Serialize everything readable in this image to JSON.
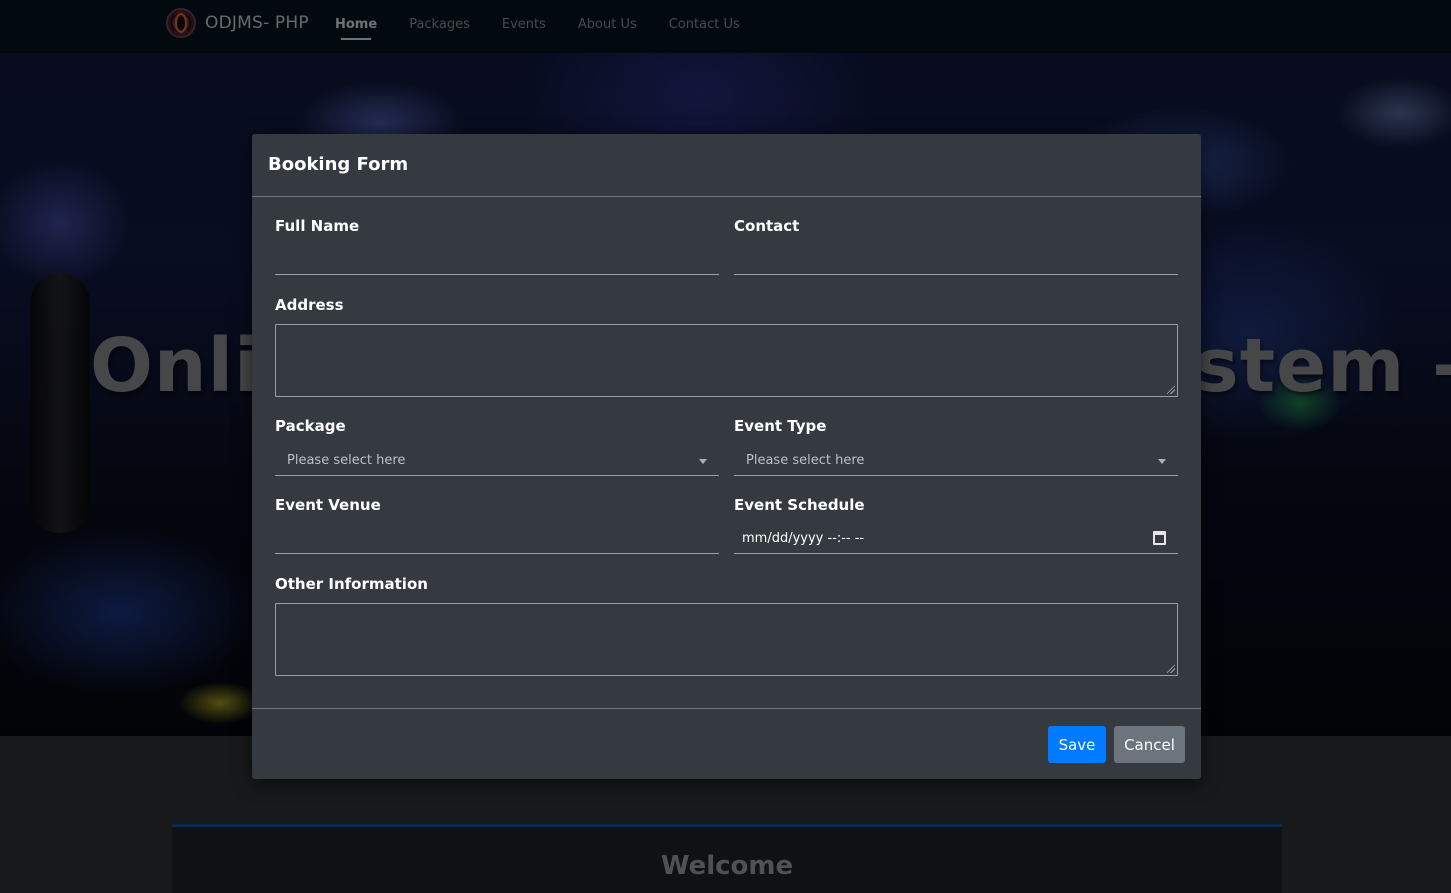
{
  "navbar": {
    "brand": "ODJMS- PHP",
    "items": [
      {
        "label": "Home",
        "active": true
      },
      {
        "label": "Packages",
        "active": false
      },
      {
        "label": "Events",
        "active": false
      },
      {
        "label": "About Us",
        "active": false
      },
      {
        "label": "Contact Us",
        "active": false
      }
    ]
  },
  "hero": {
    "title": "Online DJ Management System - PHP"
  },
  "welcome": {
    "title": "Welcome"
  },
  "modal": {
    "title": "Booking Form",
    "fields": {
      "full_name": {
        "label": "Full Name",
        "value": ""
      },
      "contact": {
        "label": "Contact",
        "value": ""
      },
      "address": {
        "label": "Address",
        "value": ""
      },
      "package": {
        "label": "Package",
        "placeholder": "Please select here"
      },
      "event_type": {
        "label": "Event Type",
        "placeholder": "Please select here"
      },
      "event_venue": {
        "label": "Event Venue",
        "value": ""
      },
      "event_schedule": {
        "label": "Event Schedule",
        "value": "mm/dd/yyyy --:-- --"
      },
      "other_info": {
        "label": "Other Information",
        "value": ""
      }
    },
    "buttons": {
      "save": "Save",
      "cancel": "Cancel"
    }
  },
  "colors": {
    "navbar_bg": "#04131f",
    "modal_bg": "#343a40",
    "primary": "#007bff",
    "secondary": "#6c757d",
    "accent_border": "#0d57a8"
  }
}
